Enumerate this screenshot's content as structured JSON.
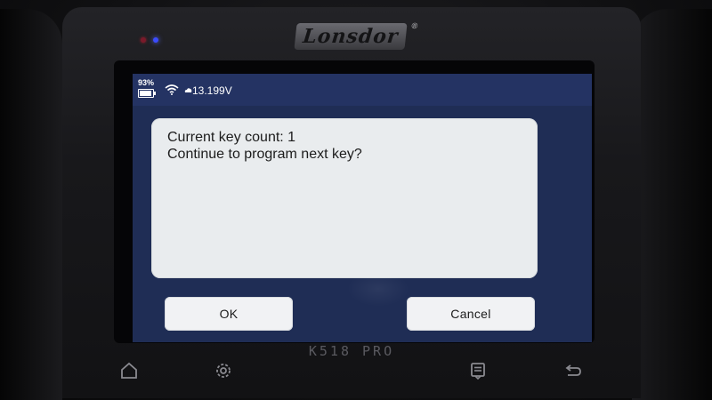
{
  "device": {
    "brand": "Lonsdor",
    "brand_mark": "®",
    "model": "K518 PRO"
  },
  "statusbar": {
    "battery_percent": "93%",
    "battery_level": 0.93,
    "wifi_icon": "wifi-icon",
    "power_icon": "cloud-icon",
    "voltage": "13.199V"
  },
  "dialog": {
    "line1": "Current key count: 1",
    "line2": "Continue to program next key?"
  },
  "buttons": {
    "ok_label": "OK",
    "cancel_label": "Cancel"
  },
  "nav": {
    "icons": [
      "home-icon",
      "settings-icon",
      "menu-icon",
      "back-icon"
    ]
  },
  "colors": {
    "screen_bg": "#1f2d55",
    "statusbar_bg": "#243363",
    "dialog_bg": "#e9ecee",
    "button_bg": "#f1f2f4",
    "led_blue": "#3b4bff",
    "led_red": "#7a1a2a"
  }
}
